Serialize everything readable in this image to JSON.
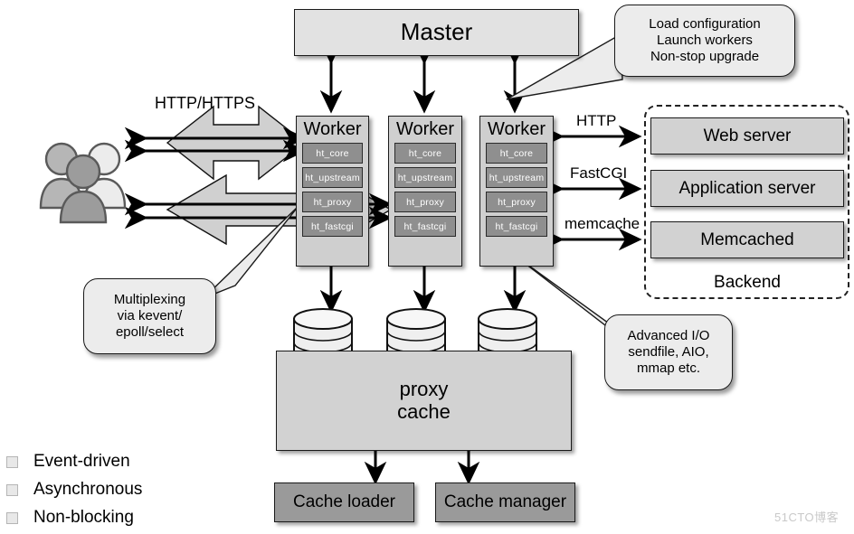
{
  "diagram": {
    "title_box": {
      "label": "Master"
    },
    "workers": [
      {
        "title": "Worker",
        "modules": [
          "ht_core",
          "ht_upstream",
          "ht_proxy",
          "ht_fastcgi"
        ]
      },
      {
        "title": "Worker",
        "modules": [
          "ht_core",
          "ht_upstream",
          "ht_proxy",
          "ht_fastcgi"
        ]
      },
      {
        "title": "Worker",
        "modules": [
          "ht_core",
          "ht_upstream",
          "ht_proxy",
          "ht_fastcgi"
        ]
      }
    ],
    "client_label": "HTTP/HTTPS",
    "client_icon": "users-icon",
    "protocols": [
      {
        "label": "HTTP"
      },
      {
        "label": "FastCGI"
      },
      {
        "label": "memcache"
      }
    ],
    "backend": {
      "label": "Backend",
      "services": [
        "Web server",
        "Application server",
        "Memcached"
      ]
    },
    "cache": {
      "storage_label_line1": "proxy",
      "storage_label_line2": "cache",
      "workers": [
        "Cache loader",
        "Cache manager"
      ]
    },
    "callouts": [
      {
        "name": "master-callout",
        "lines": [
          "Load configuration",
          "Launch workers",
          "Non-stop upgrade"
        ]
      },
      {
        "name": "multiplexing-callout",
        "lines": [
          "Multiplexing",
          "via kevent/",
          "epoll/select"
        ]
      },
      {
        "name": "advanced-io-callout",
        "lines": [
          "Advanced I/O",
          "sendfile, AIO,",
          "mmap etc."
        ]
      }
    ],
    "features": [
      "Event-driven",
      "Asynchronous",
      "Non-blocking"
    ],
    "watermark": "51CTO博客",
    "colors": {
      "box_fill": "#d2d2d2",
      "box_light": "#e2e2e2",
      "box_dark": "#9a9a9a",
      "module_fill": "#8f8f8f",
      "arrow_fill": "#d0d0d0",
      "stroke": "#1a1a1a"
    }
  }
}
